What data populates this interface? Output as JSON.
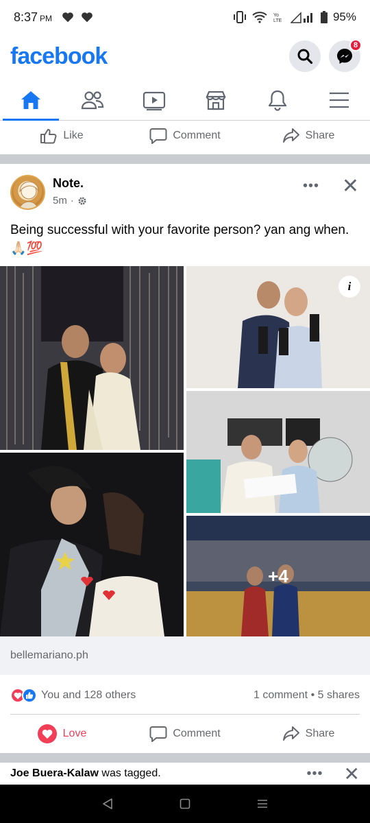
{
  "status_bar": {
    "time": "8:37",
    "ampm": "PM",
    "battery": "95%"
  },
  "header": {
    "logo": "facebook",
    "messenger_badge": "8"
  },
  "tabs": [
    {
      "name": "home",
      "icon": "home-icon",
      "active": true
    },
    {
      "name": "friends",
      "icon": "friends-icon",
      "active": false
    },
    {
      "name": "watch",
      "icon": "watch-icon",
      "active": false
    },
    {
      "name": "marketplace",
      "icon": "marketplace-icon",
      "active": false
    },
    {
      "name": "notifications",
      "icon": "bell-icon",
      "active": false
    },
    {
      "name": "menu",
      "icon": "menu-icon",
      "active": false
    }
  ],
  "prev_post_actions": {
    "like": "Like",
    "comment": "Comment",
    "share": "Share"
  },
  "post": {
    "author": "Note.",
    "time": "5m",
    "caption": "Being successful with your favorite person? yan ang when. 🙏🏻💯",
    "photo_overlay_count": "+4",
    "link_domain": "bellemariano.ph",
    "reactions_text": "You and 128 others",
    "comments_count": "1 comment",
    "shares_count": "5 shares",
    "actions": {
      "love": "Love",
      "comment": "Comment",
      "share": "Share"
    }
  },
  "next_post": {
    "author": "Joe Buera-Kalaw",
    "text": " was tagged."
  },
  "colors": {
    "brand": "#1877f2",
    "love": "#f33e58",
    "separator": "#c9ccd1"
  }
}
